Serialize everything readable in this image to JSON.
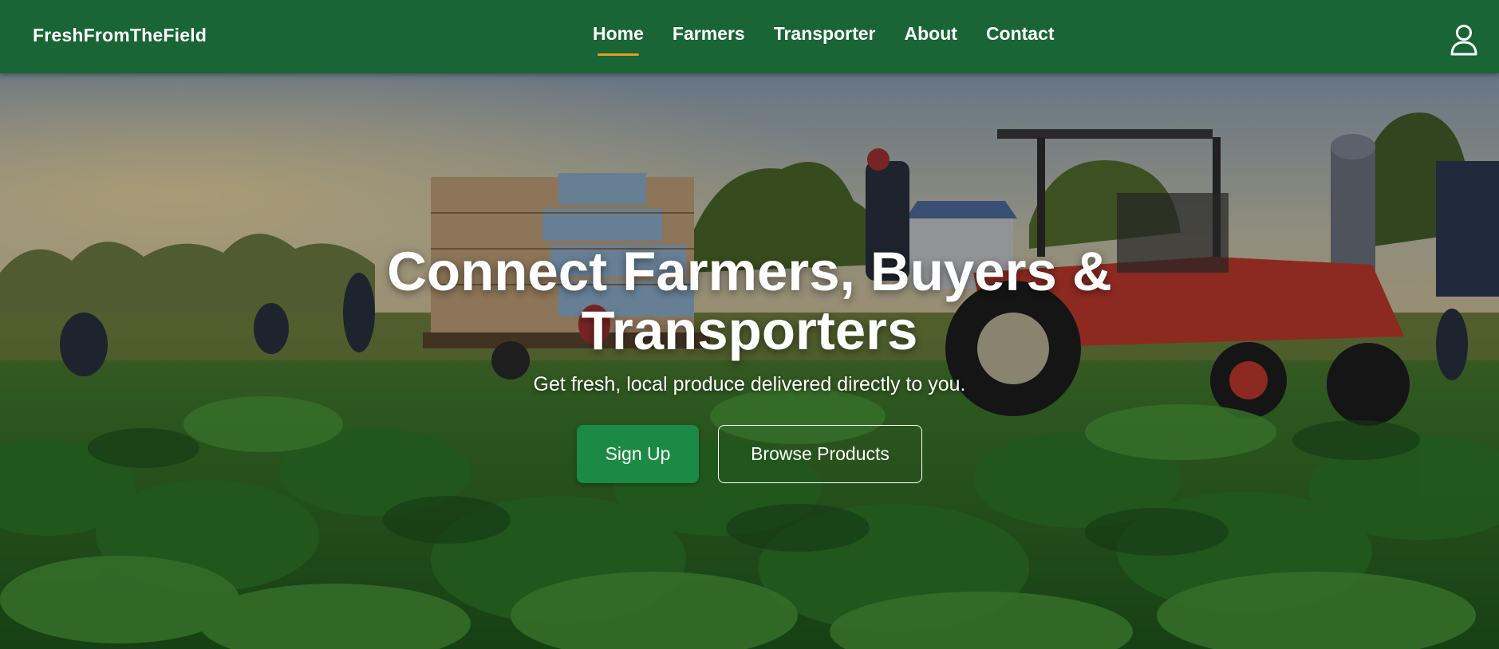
{
  "navbar": {
    "brand": "FreshFromTheField",
    "links": [
      "Home",
      "Farmers",
      "Transporter",
      "About",
      "Contact"
    ],
    "active_link": "Home",
    "user_icon": "user-icon",
    "bg_color": "#196535",
    "active_underline_color": "#e0a020"
  },
  "hero": {
    "title": "Connect Farmers, Buyers & Transporters",
    "subtitle": "Get fresh, local produce delivered directly to you.",
    "primary_button": "Sign Up",
    "secondary_button": "Browse Products",
    "primary_button_color": "#1b8a44",
    "background_image": "farm-field-with-tractor-and-workers"
  }
}
